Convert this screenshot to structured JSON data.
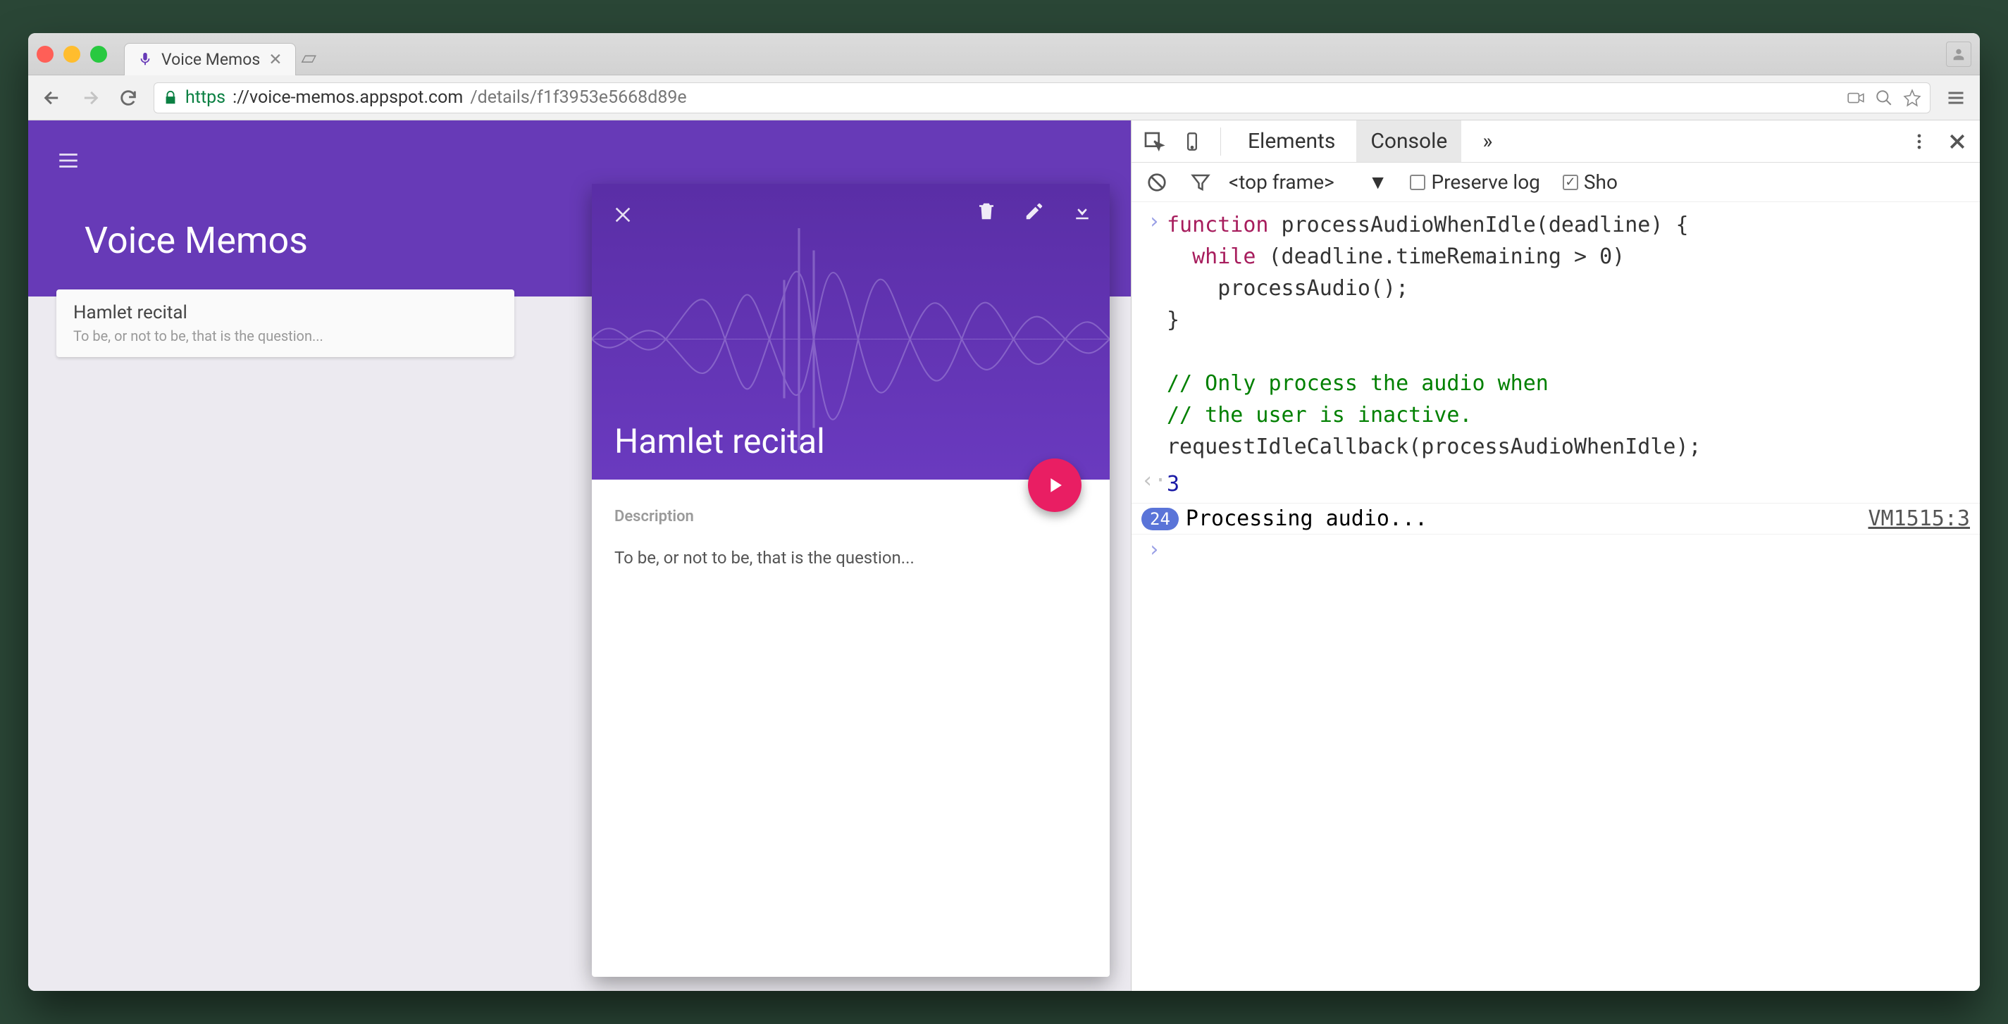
{
  "browser": {
    "tab_title": "Voice Memos",
    "url_proto": "https",
    "url_host": "://voice-memos.appspot.com",
    "url_path": "/details/f1f3953e5668d89e"
  },
  "app": {
    "title": "Voice Memos",
    "list": [
      {
        "title": "Hamlet recital",
        "subtitle": "To be, or not to be, that is the question..."
      }
    ],
    "detail": {
      "title": "Hamlet recital",
      "description_label": "Description",
      "description_text": "To be, or not to be, that is the question..."
    }
  },
  "devtools": {
    "tabs": {
      "elements": "Elements",
      "console": "Console",
      "more": "»"
    },
    "toolbar": {
      "context": "<top frame>",
      "preserve_label": "Preserve log",
      "show_label": "Sho",
      "preserve_checked": false,
      "show_checked": true
    },
    "code_lines": [
      {
        "t": "kw",
        "s": "function"
      },
      {
        "t": "fn",
        "s": " processAudioWhenIdle(deadline) {"
      },
      {
        "t": "nl"
      },
      {
        "t": "fn",
        "s": "  "
      },
      {
        "t": "kw",
        "s": "while"
      },
      {
        "t": "fn",
        "s": " (deadline.timeRemaining > 0)"
      },
      {
        "t": "nl"
      },
      {
        "t": "fn",
        "s": "    processAudio();"
      },
      {
        "t": "nl"
      },
      {
        "t": "fn",
        "s": "}"
      },
      {
        "t": "nl"
      },
      {
        "t": "nl"
      },
      {
        "t": "cm",
        "s": "// Only process the audio when"
      },
      {
        "t": "nl"
      },
      {
        "t": "cm",
        "s": "// the user is inactive."
      },
      {
        "t": "nl"
      },
      {
        "t": "fn",
        "s": "requestIdleCallback(processAudioWhenIdle);"
      }
    ],
    "result_value": "3",
    "log": {
      "count": "24",
      "message": "Processing audio...",
      "source": "VM1515:3"
    }
  }
}
